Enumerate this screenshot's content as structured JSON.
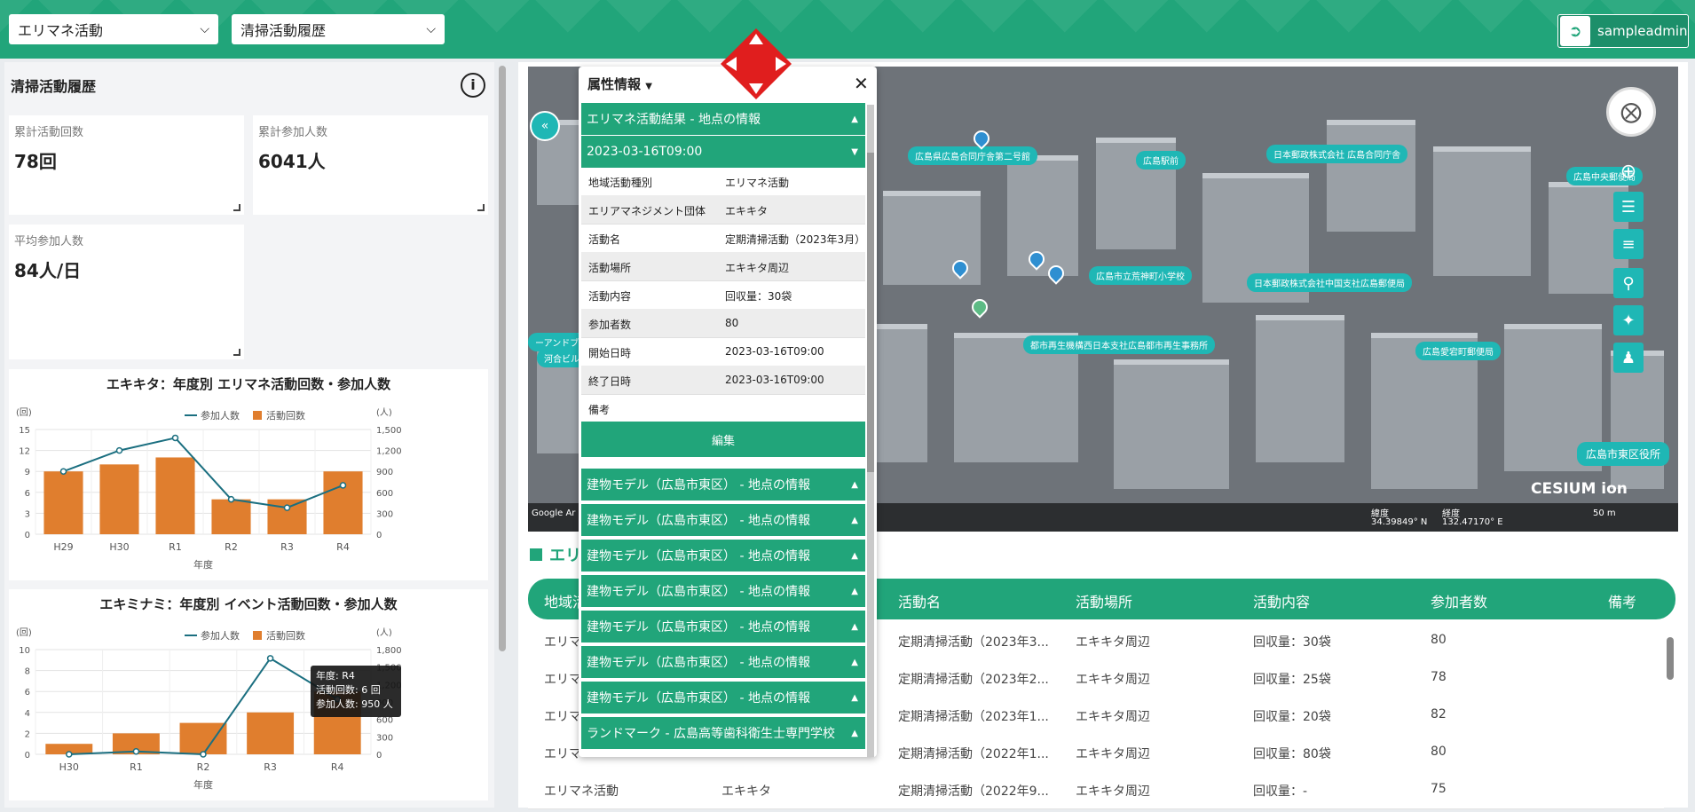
{
  "header": {
    "select1": "エリマネ活動",
    "select2": "清掃活動履歴",
    "user": "sampleadmin"
  },
  "left": {
    "title": "清掃活動履歴",
    "stats": [
      {
        "label": "累計活動回数",
        "value": "78回"
      },
      {
        "label": "累計参加人数",
        "value": "6041人"
      },
      {
        "label": "平均参加人数",
        "value": "84人/日"
      }
    ]
  },
  "chart_data": [
    {
      "type": "bar",
      "title": "エキキタ：年度別 エリマネ活動回数・参加人数",
      "categories": [
        "H29",
        "H30",
        "R1",
        "R2",
        "R3",
        "R4"
      ],
      "series": [
        {
          "name": "活動回数",
          "type": "bar",
          "axis": "left",
          "values": [
            9,
            10,
            11,
            5,
            5,
            9
          ]
        },
        {
          "name": "参加人数",
          "type": "line",
          "axis": "right",
          "values": [
            900,
            1200,
            1380,
            500,
            380,
            700
          ]
        }
      ],
      "xlabel": "年度",
      "ylabel_left": "(回)",
      "ylabel_right": "(人)",
      "ylim_left": [
        0,
        15
      ],
      "ylim_right": [
        0,
        1500
      ],
      "yticks_left": [
        "15",
        "12",
        "9",
        "6",
        "3",
        "0"
      ],
      "yticks_right": [
        "1,500",
        "1,200",
        "900",
        "600",
        "300",
        "0"
      ],
      "legend": "top-center"
    },
    {
      "type": "bar",
      "title": "エキミナミ：年度別 イベント活動回数・参加人数",
      "categories": [
        "H30",
        "R1",
        "R2",
        "R3",
        "R4"
      ],
      "series": [
        {
          "name": "活動回数",
          "type": "bar",
          "axis": "left",
          "values": [
            1,
            2,
            3,
            4,
            6
          ]
        },
        {
          "name": "参加人数",
          "type": "line",
          "axis": "right",
          "values": [
            0,
            50,
            0,
            1650,
            950
          ]
        }
      ],
      "xlabel": "年度",
      "ylabel_left": "(回)",
      "ylabel_right": "(人)",
      "ylim_left": [
        0,
        10
      ],
      "ylim_right": [
        0,
        1800
      ],
      "yticks_left": [
        "10",
        "8",
        "6",
        "4",
        "2",
        "0"
      ],
      "yticks_right": [
        "1,800",
        "1,500",
        "1,200",
        "900",
        "600",
        "300",
        "0"
      ],
      "legend": "top-center",
      "tooltip": [
        "年度: R4",
        "活動回数: 6 回",
        "参加人数: 950 人"
      ]
    }
  ],
  "map": {
    "labels": [
      "広島県広島合同庁舎第二号館",
      "広島駅前",
      "日本郵政株式会社 広島合同庁舎",
      "広島市立荒神町小学校",
      "広島中央郵便局",
      "都市再生機構西日本支社広島都市再生事務所",
      "日本郵政株式会社中国支社広島郵便局",
      "広島愛宕町郵便局",
      "広島市東区役所",
      "河合ビル",
      "ーアンドブ"
    ],
    "bottom_left": "Google Ar",
    "lat_label": "緯度",
    "lat_value": "34.39849° N",
    "lon_label": "経度",
    "lon_value": "132.47170° E",
    "scale": "50 m",
    "brand": "CESIUM ion"
  },
  "popup": {
    "title": "属性情報",
    "section": "エリマネ活動結果 - 地点の情報",
    "subsection": "2023-03-16T09:00",
    "rows": [
      {
        "k": "地域活動種別",
        "v": "エリマネ活動"
      },
      {
        "k": "エリアマネジメント団体",
        "v": "エキキタ"
      },
      {
        "k": "活動名",
        "v": "定期清掃活動（2023年3月）"
      },
      {
        "k": "活動場所",
        "v": "エキキタ周辺"
      },
      {
        "k": "活動内容",
        "v": "回収量：30袋"
      },
      {
        "k": "参加者数",
        "v": "80"
      },
      {
        "k": "開始日時",
        "v": "2023-03-16T09:00"
      },
      {
        "k": "終了日時",
        "v": "2023-03-16T09:00"
      },
      {
        "k": "備考",
        "v": ""
      }
    ],
    "edit": "編集",
    "others": [
      "建物モデル（広島市東区） - 地点の情報",
      "建物モデル（広島市東区） - 地点の情報",
      "建物モデル（広島市東区） - 地点の情報",
      "建物モデル（広島市東区） - 地点の情報",
      "建物モデル（広島市東区） - 地点の情報",
      "建物モデル（広島市東区） - 地点の情報",
      "建物モデル（広島市東区） - 地点の情報",
      "ランドマーク - 広島高等歯科衛生士専門学校"
    ]
  },
  "table": {
    "title": "エリ",
    "columns": [
      "地域活",
      "活動名",
      "活動場所",
      "活動内容",
      "参加者数",
      "備考"
    ],
    "rows": [
      [
        "エリマ",
        "",
        "定期清掃活動（2023年3...",
        "エキキタ周辺",
        "回収量：30袋",
        "80"
      ],
      [
        "エリマ",
        "",
        "定期清掃活動（2023年2...",
        "エキキタ周辺",
        "回収量：25袋",
        "78"
      ],
      [
        "エリマ",
        "",
        "定期清掃活動（2023年1...",
        "エキキタ周辺",
        "回収量：20袋",
        "82"
      ],
      [
        "エリマ",
        "",
        "定期清掃活動（2022年1...",
        "エキキタ周辺",
        "回収量：80袋",
        "80"
      ],
      [
        "エリマネ活動",
        "エキキタ",
        "定期清掃活動（2022年9...",
        "エキキタ周辺",
        "回収量：-",
        "75"
      ]
    ]
  }
}
